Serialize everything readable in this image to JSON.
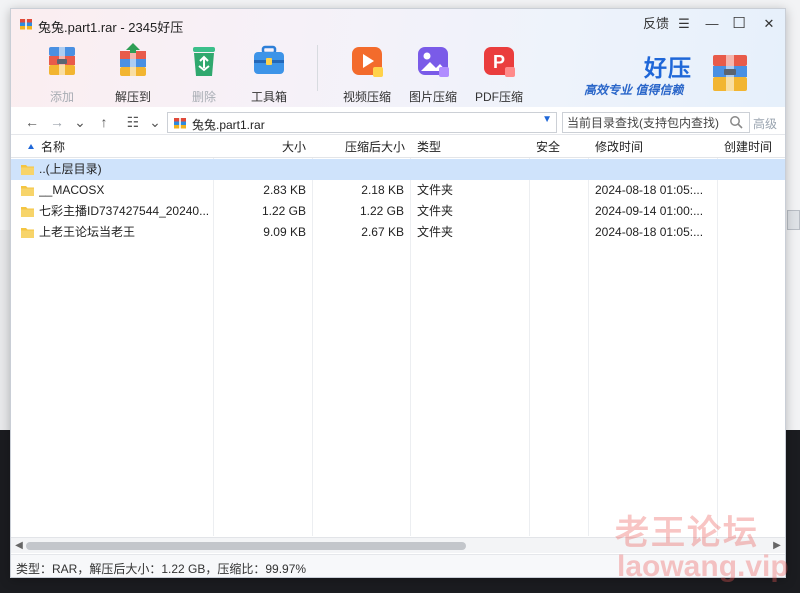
{
  "window": {
    "title": "兔兔.part1.rar - 2345好压",
    "feedback_label": "反馈",
    "menu_glyph": "☰",
    "minimize_glyph": "—",
    "maximize_glyph": "☐",
    "close_glyph": "✕"
  },
  "toolbar": {
    "buttons": [
      {
        "label": "添加",
        "icon": "add-archive-icon",
        "enabled": false
      },
      {
        "label": "解压到",
        "icon": "extract-icon",
        "enabled": true
      },
      {
        "label": "删除",
        "icon": "recycle-icon",
        "enabled": false
      },
      {
        "label": "工具箱",
        "icon": "toolbox-icon",
        "enabled": true
      },
      {
        "label": "视频压缩",
        "icon": "video-compress-icon",
        "enabled": true
      },
      {
        "label": "图片压缩",
        "icon": "image-compress-icon",
        "enabled": true
      },
      {
        "label": "PDF压缩",
        "icon": "pdf-compress-icon",
        "enabled": true
      }
    ]
  },
  "brand": {
    "name": "好压",
    "slogan": "高效专业  值得信赖"
  },
  "nav": {
    "back_glyph": "←",
    "forward_glyph": "→",
    "history_glyph": "⌄",
    "up_glyph": "↑",
    "view_glyph": "☷",
    "view_drop_glyph": "⌄",
    "path": "兔兔.part1.rar",
    "path_dropdown_glyph": "▼",
    "search_placeholder": "当前目录查找(支持包内查找)",
    "advanced_label": "高级"
  },
  "table": {
    "columns": [
      "名称",
      "大小",
      "压缩后大小",
      "类型",
      "安全",
      "修改时间",
      "创建时间"
    ],
    "rows": [
      {
        "name": "..(上层目录)",
        "size": "",
        "packed": "",
        "type": "",
        "security": "",
        "modified": "",
        "created": ""
      },
      {
        "name": "__MACOSX",
        "size": "2.83 KB",
        "packed": "2.18 KB",
        "type": "文件夹",
        "security": "",
        "modified": "2024-08-18 01:05:...",
        "created": ""
      },
      {
        "name": "七彩主播ID737427544_20240...",
        "size": "1.22 GB",
        "packed": "1.22 GB",
        "type": "文件夹",
        "security": "",
        "modified": "2024-09-14 01:00:...",
        "created": ""
      },
      {
        "name": "上老王论坛当老王",
        "size": "9.09 KB",
        "packed": "2.67 KB",
        "type": "文件夹",
        "security": "",
        "modified": "2024-08-18 01:05:...",
        "created": ""
      }
    ],
    "selected_row": 0
  },
  "scroll": {
    "left_glyph": "◀",
    "right_glyph": "▶"
  },
  "status": "类型：RAR，解压后大小：1.22 GB，压缩比：99.97%",
  "watermark": {
    "cn": "老王论坛",
    "en": "laowang.vip"
  },
  "colors": {
    "accent": "#1f67d8",
    "selection": "#cfe3fb",
    "folder": "#f4c542"
  }
}
